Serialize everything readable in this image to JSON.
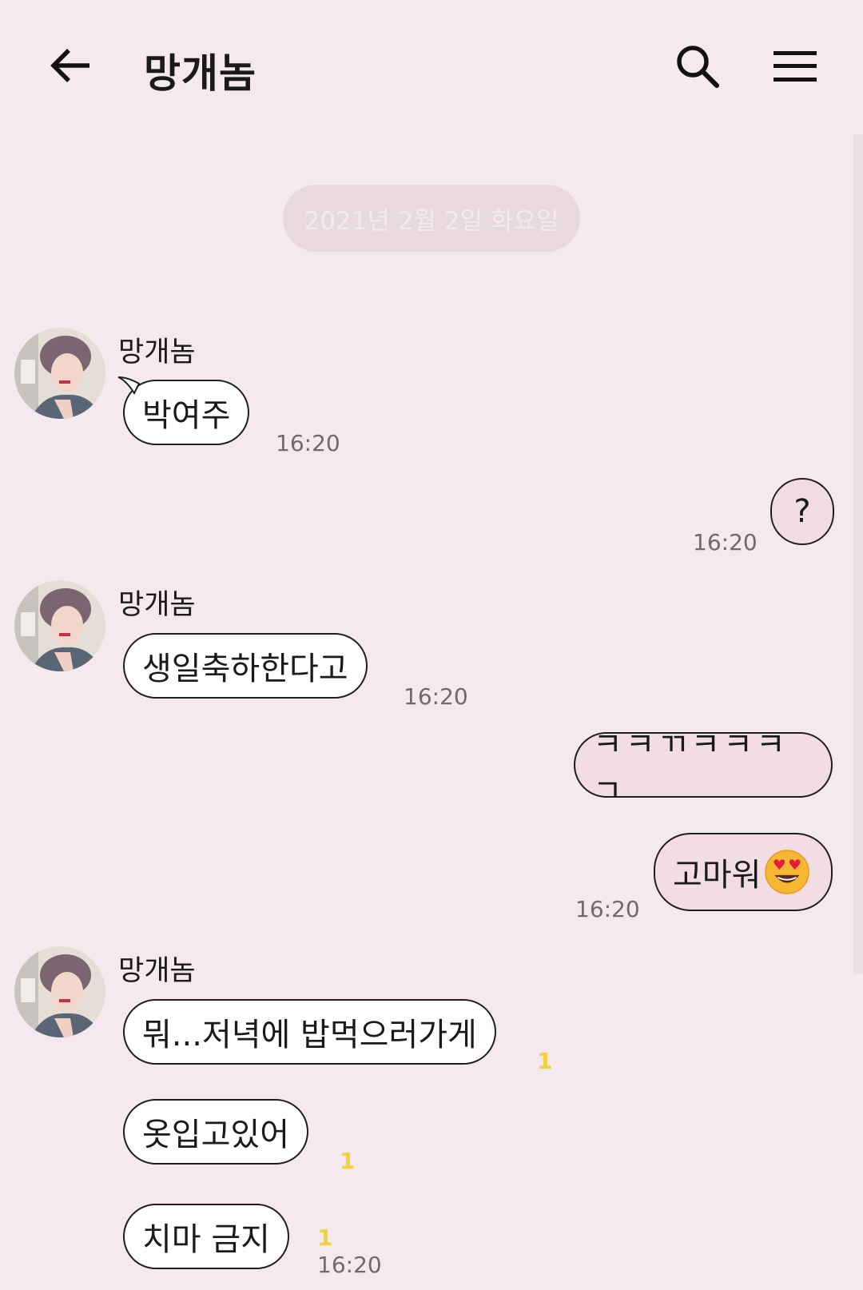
{
  "header": {
    "title": "망개놈"
  },
  "date_divider": "2021년 2월 2일 화요일",
  "messages": [
    {
      "side": "in",
      "sender": "망개놈",
      "text": "박여주",
      "time": "16:20"
    },
    {
      "side": "out",
      "text": "?",
      "time": "16:20"
    },
    {
      "side": "in",
      "sender": "망개놈",
      "text": "생일축하한다고",
      "time": "16:20"
    },
    {
      "side": "out",
      "text": "ㅋㅋㄲㅋㅋㅋㄱ"
    },
    {
      "side": "out",
      "text": "고마워",
      "emoji": "heart-eyes-emoji",
      "time": "16:20"
    },
    {
      "side": "in",
      "sender": "망개놈",
      "text": "뭐...저녁에 밥먹으러가게",
      "unread": "1"
    },
    {
      "side": "in",
      "text": "옷입고있어",
      "unread": "1"
    },
    {
      "side": "in",
      "text": "치마 금지",
      "unread": "1",
      "time": "16:20"
    }
  ],
  "colors": {
    "background": "#f5e8ee",
    "outgoing_bubble": "#f3dde5",
    "incoming_bubble": "#ffffff",
    "unread": "#f1d23a"
  }
}
